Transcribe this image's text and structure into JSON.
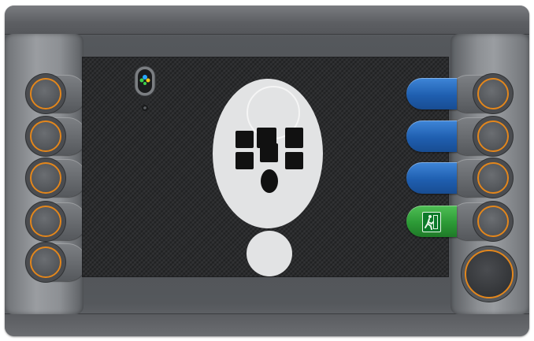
{
  "device": {
    "accent_color": "#e2861c",
    "soft_key_color": "#1f5fb0",
    "exit_key_color": "#2c9a36"
  },
  "left_buttons": [
    {
      "name": "left-bezel-button-1"
    },
    {
      "name": "left-bezel-button-2"
    },
    {
      "name": "left-bezel-button-3"
    },
    {
      "name": "left-bezel-button-4"
    },
    {
      "name": "left-bezel-button-5"
    }
  ],
  "right_buttons": [
    {
      "name": "right-bezel-button-1"
    },
    {
      "name": "right-bezel-button-2"
    },
    {
      "name": "right-bezel-button-3"
    },
    {
      "name": "right-bezel-button-4"
    }
  ],
  "soft_keys": [
    {
      "name": "soft-key-1",
      "type": "blank"
    },
    {
      "name": "soft-key-2",
      "type": "blank"
    },
    {
      "name": "soft-key-3",
      "type": "blank"
    },
    {
      "name": "exit-key",
      "type": "exit",
      "icon": "emergency-exit-icon"
    }
  ],
  "indicator": {
    "icon": "joystick-status-icon",
    "light_colors": [
      "#28a8ff",
      "#3cd04a",
      "#f2c91d"
    ]
  },
  "center": {
    "icon": "controller-layout-icon"
  }
}
